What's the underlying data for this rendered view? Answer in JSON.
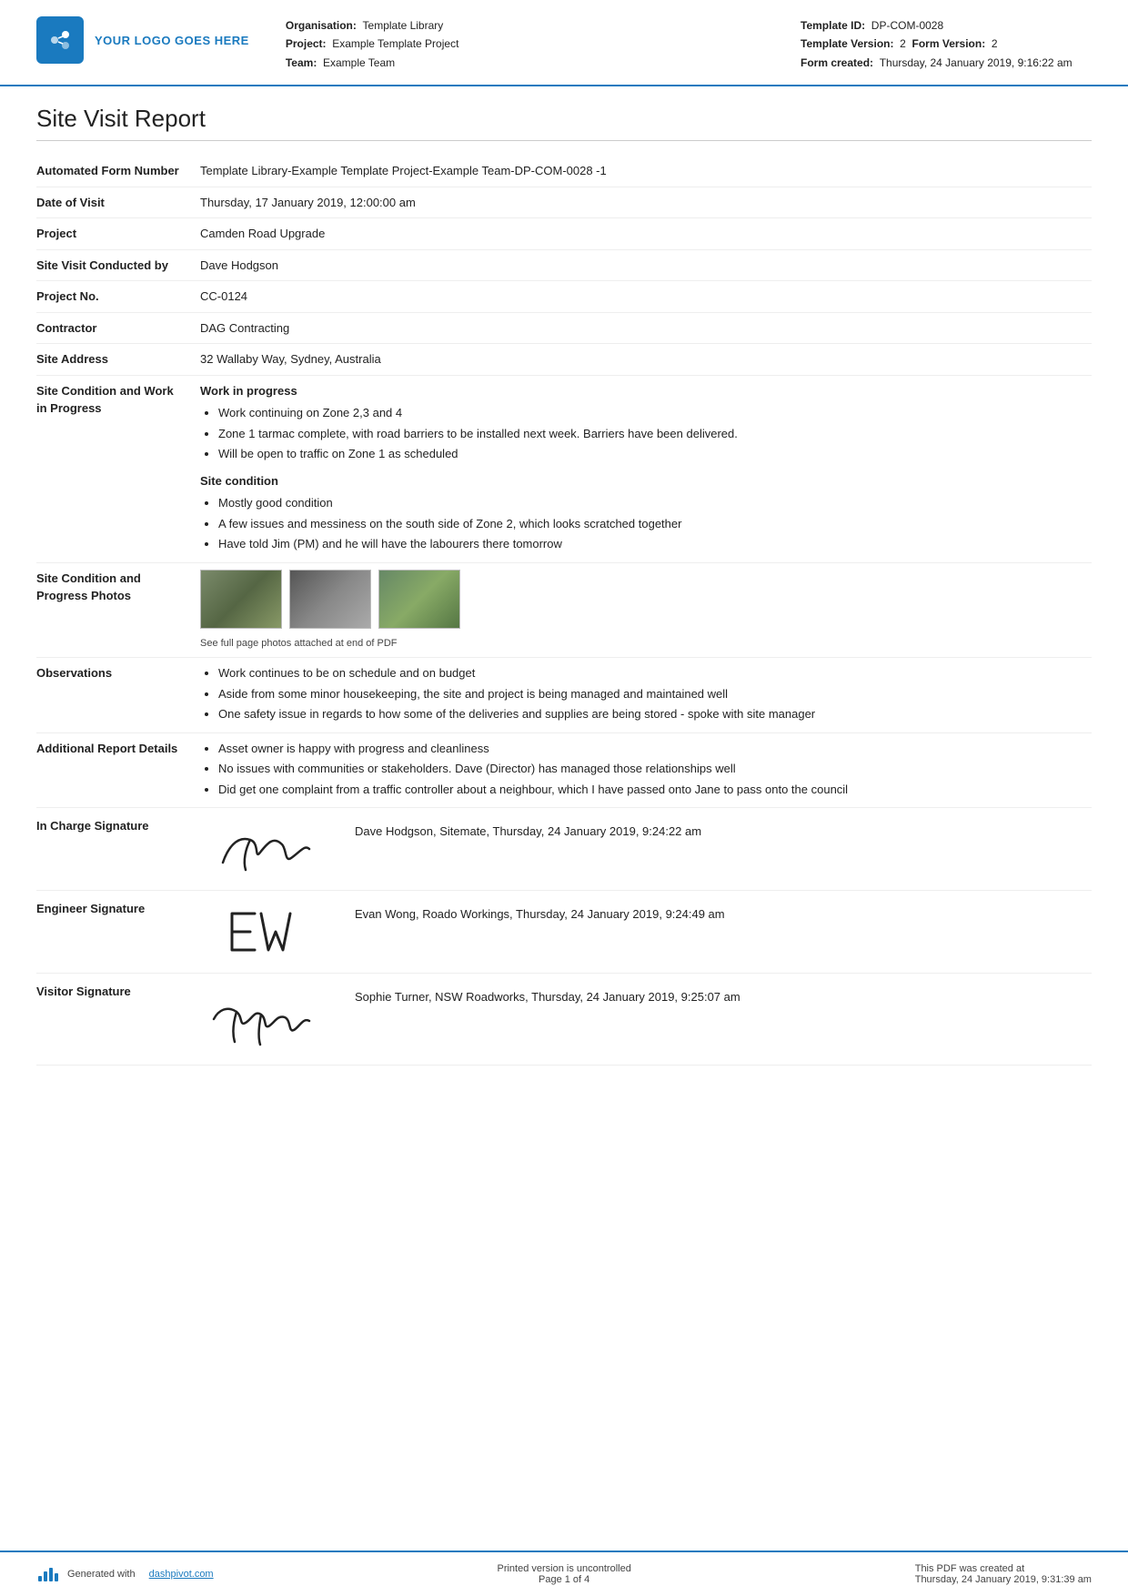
{
  "header": {
    "logo_text": "YOUR LOGO GOES HERE",
    "organisation_label": "Organisation:",
    "organisation_value": "Template Library",
    "project_label": "Project:",
    "project_value": "Example Template Project",
    "team_label": "Team:",
    "team_value": "Example Team",
    "template_id_label": "Template ID:",
    "template_id_value": "DP-COM-0028",
    "template_version_label": "Template Version:",
    "template_version_value": "2",
    "form_version_label": "Form Version:",
    "form_version_value": "2",
    "form_created_label": "Form created:",
    "form_created_value": "Thursday, 24 January 2019, 9:16:22 am"
  },
  "page_title": "Site Visit Report",
  "fields": {
    "form_number_label": "Automated Form Number",
    "form_number_value": "Template Library-Example Template Project-Example Team-DP-COM-0028   -1",
    "date_of_visit_label": "Date of Visit",
    "date_of_visit_value": "Thursday, 17 January 2019, 12:00:00 am",
    "project_label": "Project",
    "project_value": "Camden Road Upgrade",
    "site_visit_label": "Site Visit Conducted by",
    "site_visit_value": "Dave Hodgson",
    "project_no_label": "Project No.",
    "project_no_value": "CC-0124",
    "contractor_label": "Contractor",
    "contractor_value": "DAG Contracting",
    "site_address_label": "Site Address",
    "site_address_value": "32 Wallaby Way, Sydney, Australia",
    "site_condition_label": "Site Condition and Work in Progress",
    "site_condition_bold": "Work in progress",
    "site_condition_bullets": [
      "Work continuing on Zone 2,3 and 4",
      "Zone 1 tarmac complete, with road barriers to be installed next week. Barriers have been delivered.",
      "Will be open to traffic on Zone 1 as scheduled"
    ],
    "site_condition_sub": "Site condition",
    "site_condition_sub_bullets": [
      "Mostly good condition",
      "A few issues and messiness on the south side of Zone 2, which looks scratched together",
      "Have told Jim (PM) and he will have the labourers there tomorrow"
    ],
    "photos_label": "Site Condition and Progress Photos",
    "photos_caption": "See full page photos attached at end of PDF",
    "observations_label": "Observations",
    "observations_bullets": [
      "Work continues to be on schedule and on budget",
      "Aside from some minor housekeeping, the site and project is being managed and maintained well",
      "One safety issue in regards to how some of the deliveries and supplies are being stored - spoke with site manager"
    ],
    "additional_label": "Additional Report Details",
    "additional_bullets": [
      "Asset owner is happy with progress and cleanliness",
      "No issues with communities or stakeholders. Dave (Director) has managed those relationships well",
      "Did get one complaint from a traffic controller about a neighbour, which I have passed onto Jane to pass onto the council"
    ]
  },
  "signatures": {
    "in_charge_label": "In Charge Signature",
    "in_charge_info": "Dave Hodgson, Sitemate, Thursday, 24 January 2019, 9:24:22 am",
    "engineer_label": "Engineer Signature",
    "engineer_info": "Evan Wong, Roado Workings, Thursday, 24 January 2019, 9:24:49 am",
    "visitor_label": "Visitor Signature",
    "visitor_info": "Sophie Turner, NSW Roadworks, Thursday, 24 January 2019, 9:25:07 am"
  },
  "footer": {
    "generated_text": "Generated with",
    "generated_link": "dashpivot.com",
    "uncontrolled_text": "Printed version is uncontrolled",
    "page_text": "Page 1 of 4",
    "pdf_created_text": "This PDF was created at",
    "pdf_created_date": "Thursday, 24 January 2019, 9:31:39 am"
  }
}
